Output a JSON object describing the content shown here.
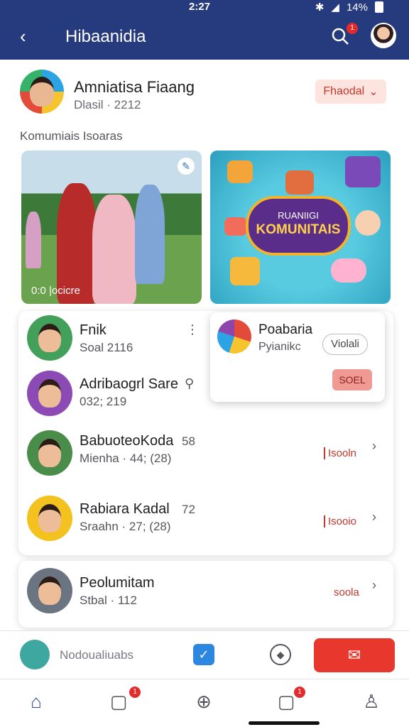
{
  "status": {
    "time": "2:27",
    "battery": "14%"
  },
  "header": {
    "title": "Hibaanidia",
    "search_badge": "1"
  },
  "profile": {
    "name": "Amniatisa Fiaang",
    "sub": "Dlasil · 2212",
    "chip_label": "Fhaodal"
  },
  "section_label": "Komumiais Isoaras",
  "media": {
    "photo_caption": "0:0  |ocicre",
    "promo_small": "RUANIIGI",
    "promo_big": "KOMUNITAIS"
  },
  "popup": {
    "name": "Poabaria",
    "sub": "Pyianikc",
    "outline_label": "Violali",
    "button_label": "SOEL"
  },
  "list": [
    {
      "name": "Fnik",
      "sub": "Soal 2116"
    },
    {
      "name": "Adribaogrl Sare",
      "sub": "032; 219"
    },
    {
      "name": "BabuoteoKoda",
      "count": "58",
      "sub": "Mienha · 44; (28)",
      "tag": "Isooln"
    },
    {
      "name": "Rabiara Kadal",
      "count": "72",
      "sub": "Sraahn · 27; (28)",
      "tag": "Isooio"
    }
  ],
  "card2": {
    "name": "Peolumitam",
    "sub": "Stbal · 112",
    "tag": "soola"
  },
  "action": {
    "label": "Nodoualiuabs"
  },
  "tabs": {
    "msg_badge": "1",
    "chat_badge": "1"
  }
}
